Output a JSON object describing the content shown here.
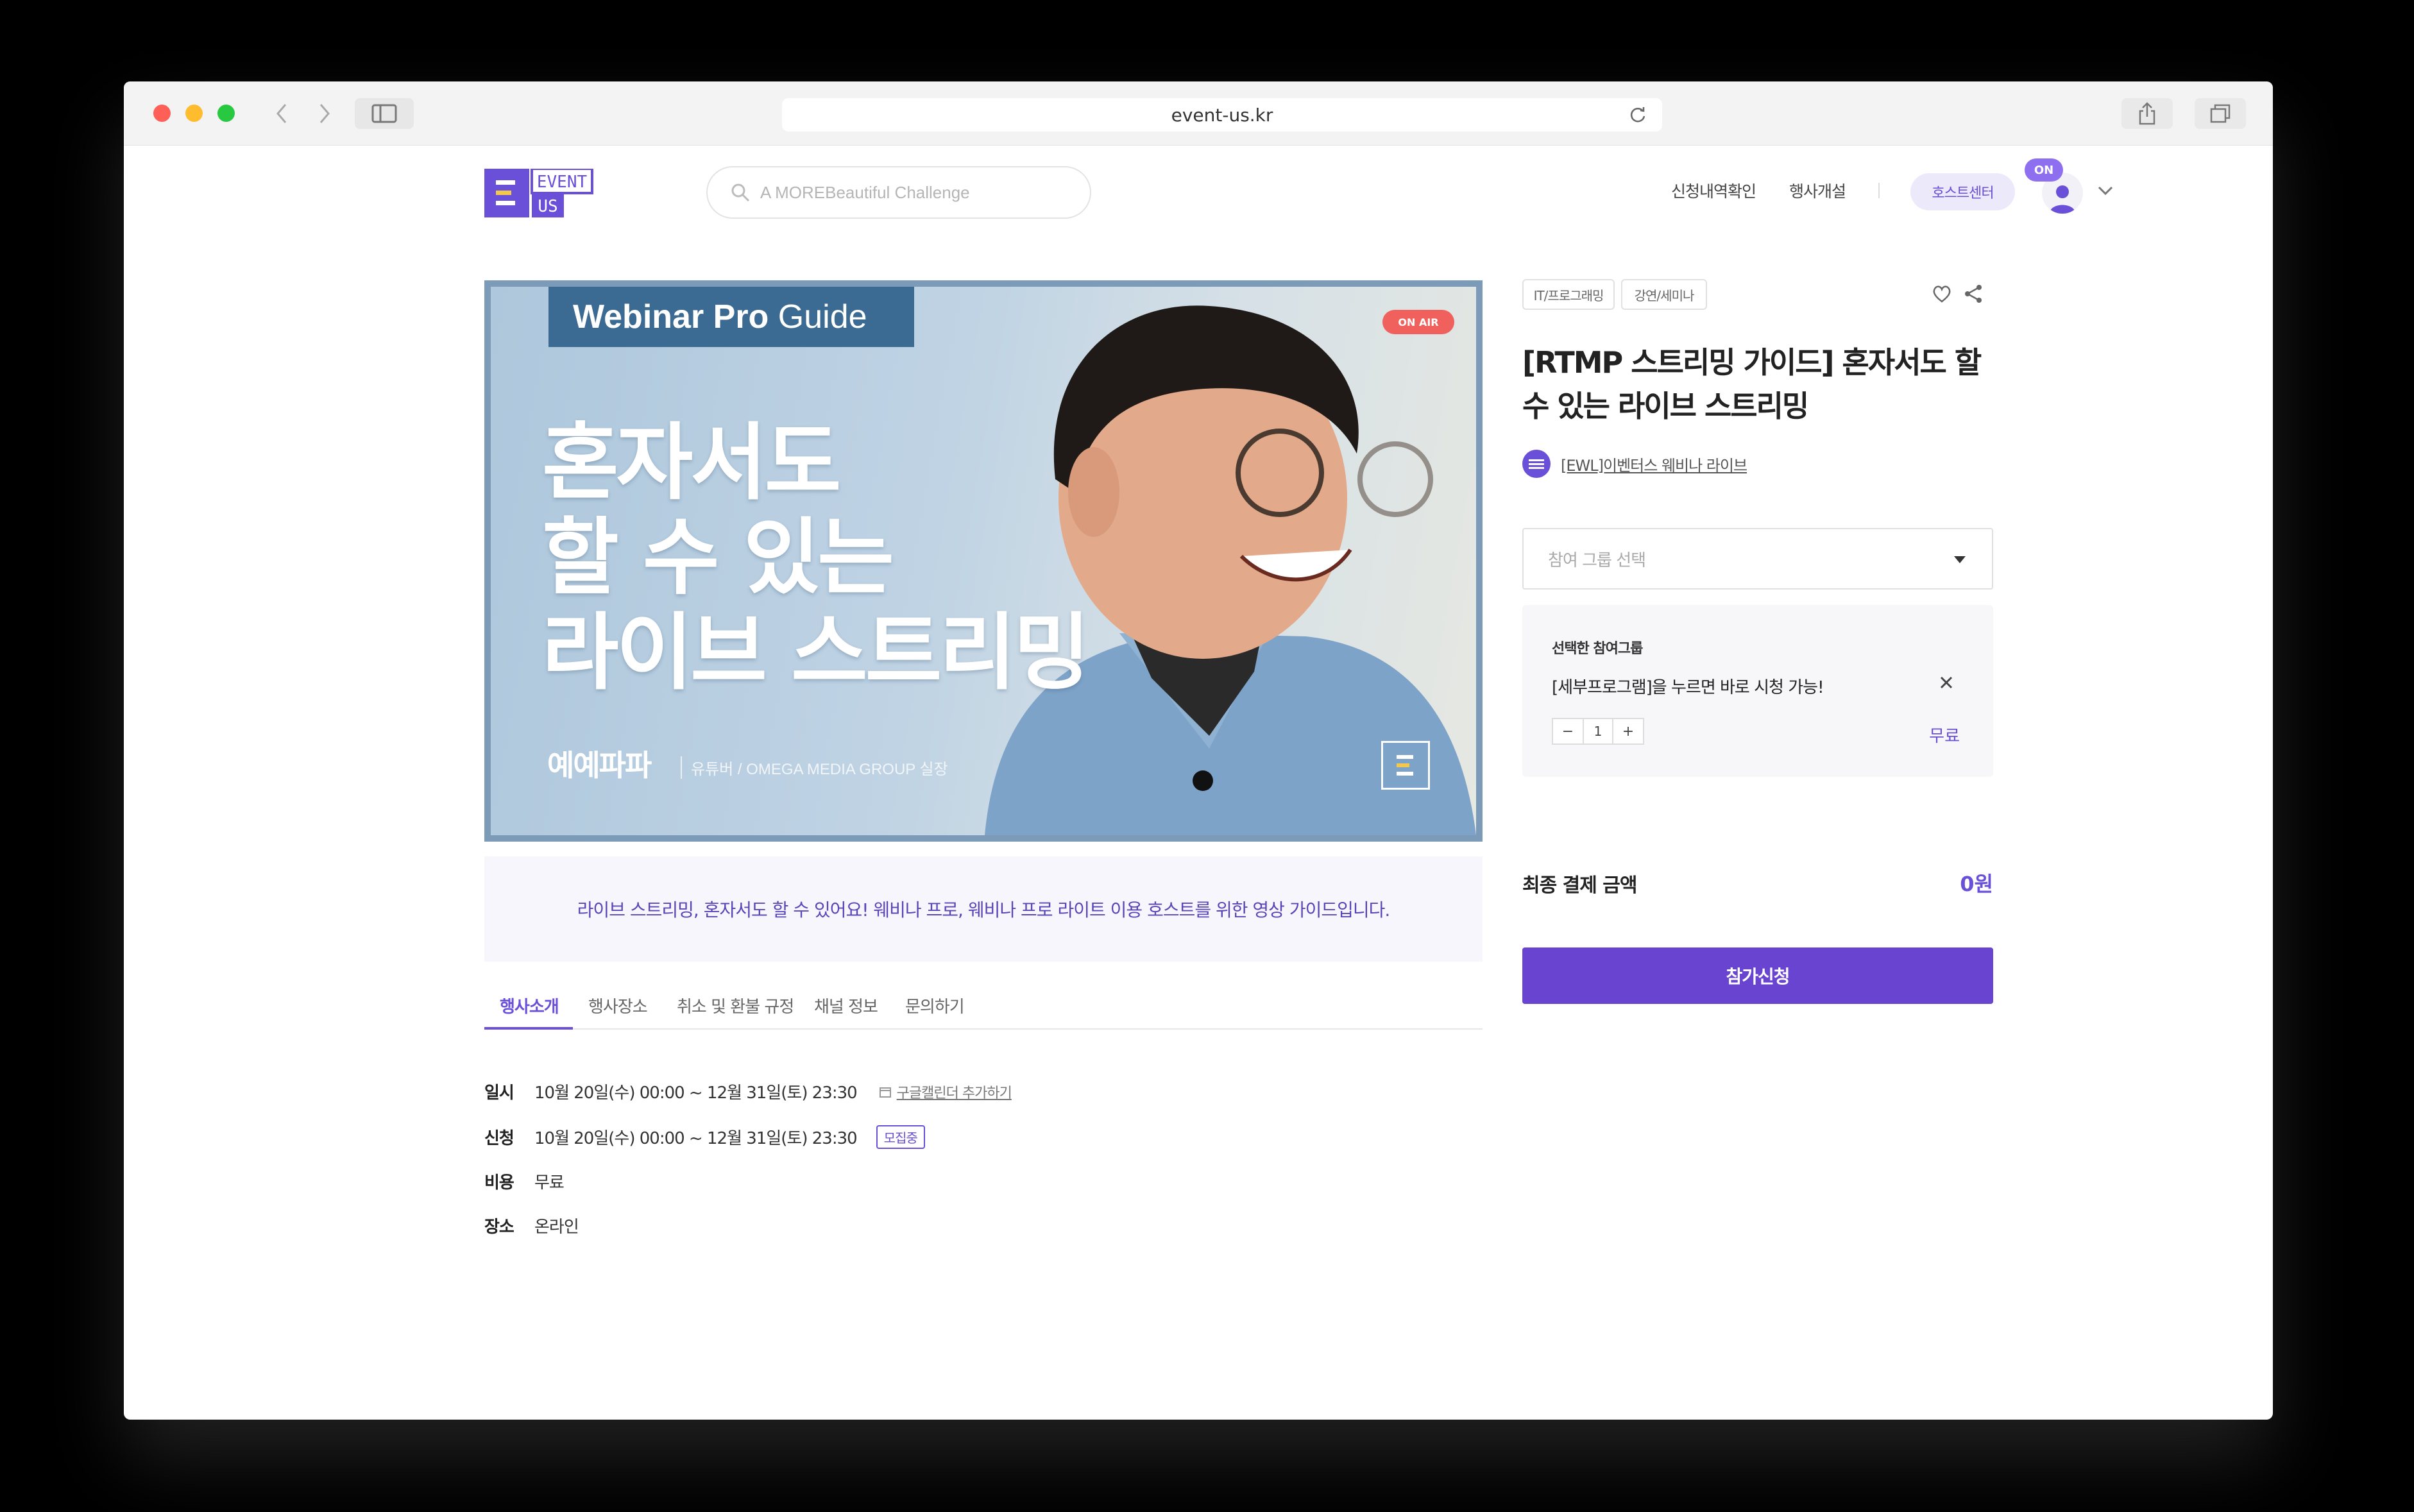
{
  "browser": {
    "url": "event-us.kr"
  },
  "header": {
    "logo_text": "EVENT US",
    "search_placeholder": "A MOREBeautiful Challenge",
    "nav": [
      "신청내역확인",
      "행사개설"
    ],
    "host_center": "호스트센터",
    "on_badge": "ON"
  },
  "banner": {
    "tag_bold": "Webinar Pro",
    "tag_light": " Guide",
    "on_air": "ON AIR",
    "headline": [
      "혼자서도",
      "할 수 있는",
      "라이브 스트리밍"
    ],
    "speaker_name": "예예파파",
    "speaker_role": "유튜버 / OMEGA MEDIA GROUP 실장"
  },
  "summary": "라이브 스트리밍, 혼자서도 할 수 있어요! 웨비나 프로, 웨비나 프로 라이트 이용 호스트를 위한 영상 가이드입니다.",
  "tabs": [
    "행사소개",
    "행사장소",
    "취소 및 환불 규정",
    "채널 정보",
    "문의하기"
  ],
  "info": {
    "date_label": "일시",
    "date_value": "10월 20일(수) 00:00 ~ 12월 31일(토) 23:30",
    "calendar_link": "구글캘린더 추가하기",
    "apply_label": "신청",
    "apply_value": "10월 20일(수) 00:00 ~ 12월 31일(토) 23:30",
    "apply_status": "모집중",
    "cost_label": "비용",
    "cost_value": "무료",
    "place_label": "장소",
    "place_value": "온라인"
  },
  "event": {
    "categories": [
      "IT/프로그래밍",
      "강연/세미나"
    ],
    "title": "[RTMP 스트리밍 가이드] 혼자서도 할 수 있는 라이브 스트리밍",
    "channel": "[EWL]이벤터스 웨비나 라이브",
    "group_select_placeholder": "참여 그룹 선택",
    "selected_group_title": "선택한 참여그룹",
    "selected_group_item": "[세부프로그램]을 누르면 바로 시청 가능!",
    "quantity": "1",
    "item_price": "무료",
    "total_label": "최종 결제 금액",
    "total_value": "0원",
    "apply_button": "참가신청"
  },
  "colors": {
    "accent": "#6a4fd8",
    "button": "#6844d1",
    "on_air": "#f0605c",
    "banner_border": "#7b9bb9"
  }
}
